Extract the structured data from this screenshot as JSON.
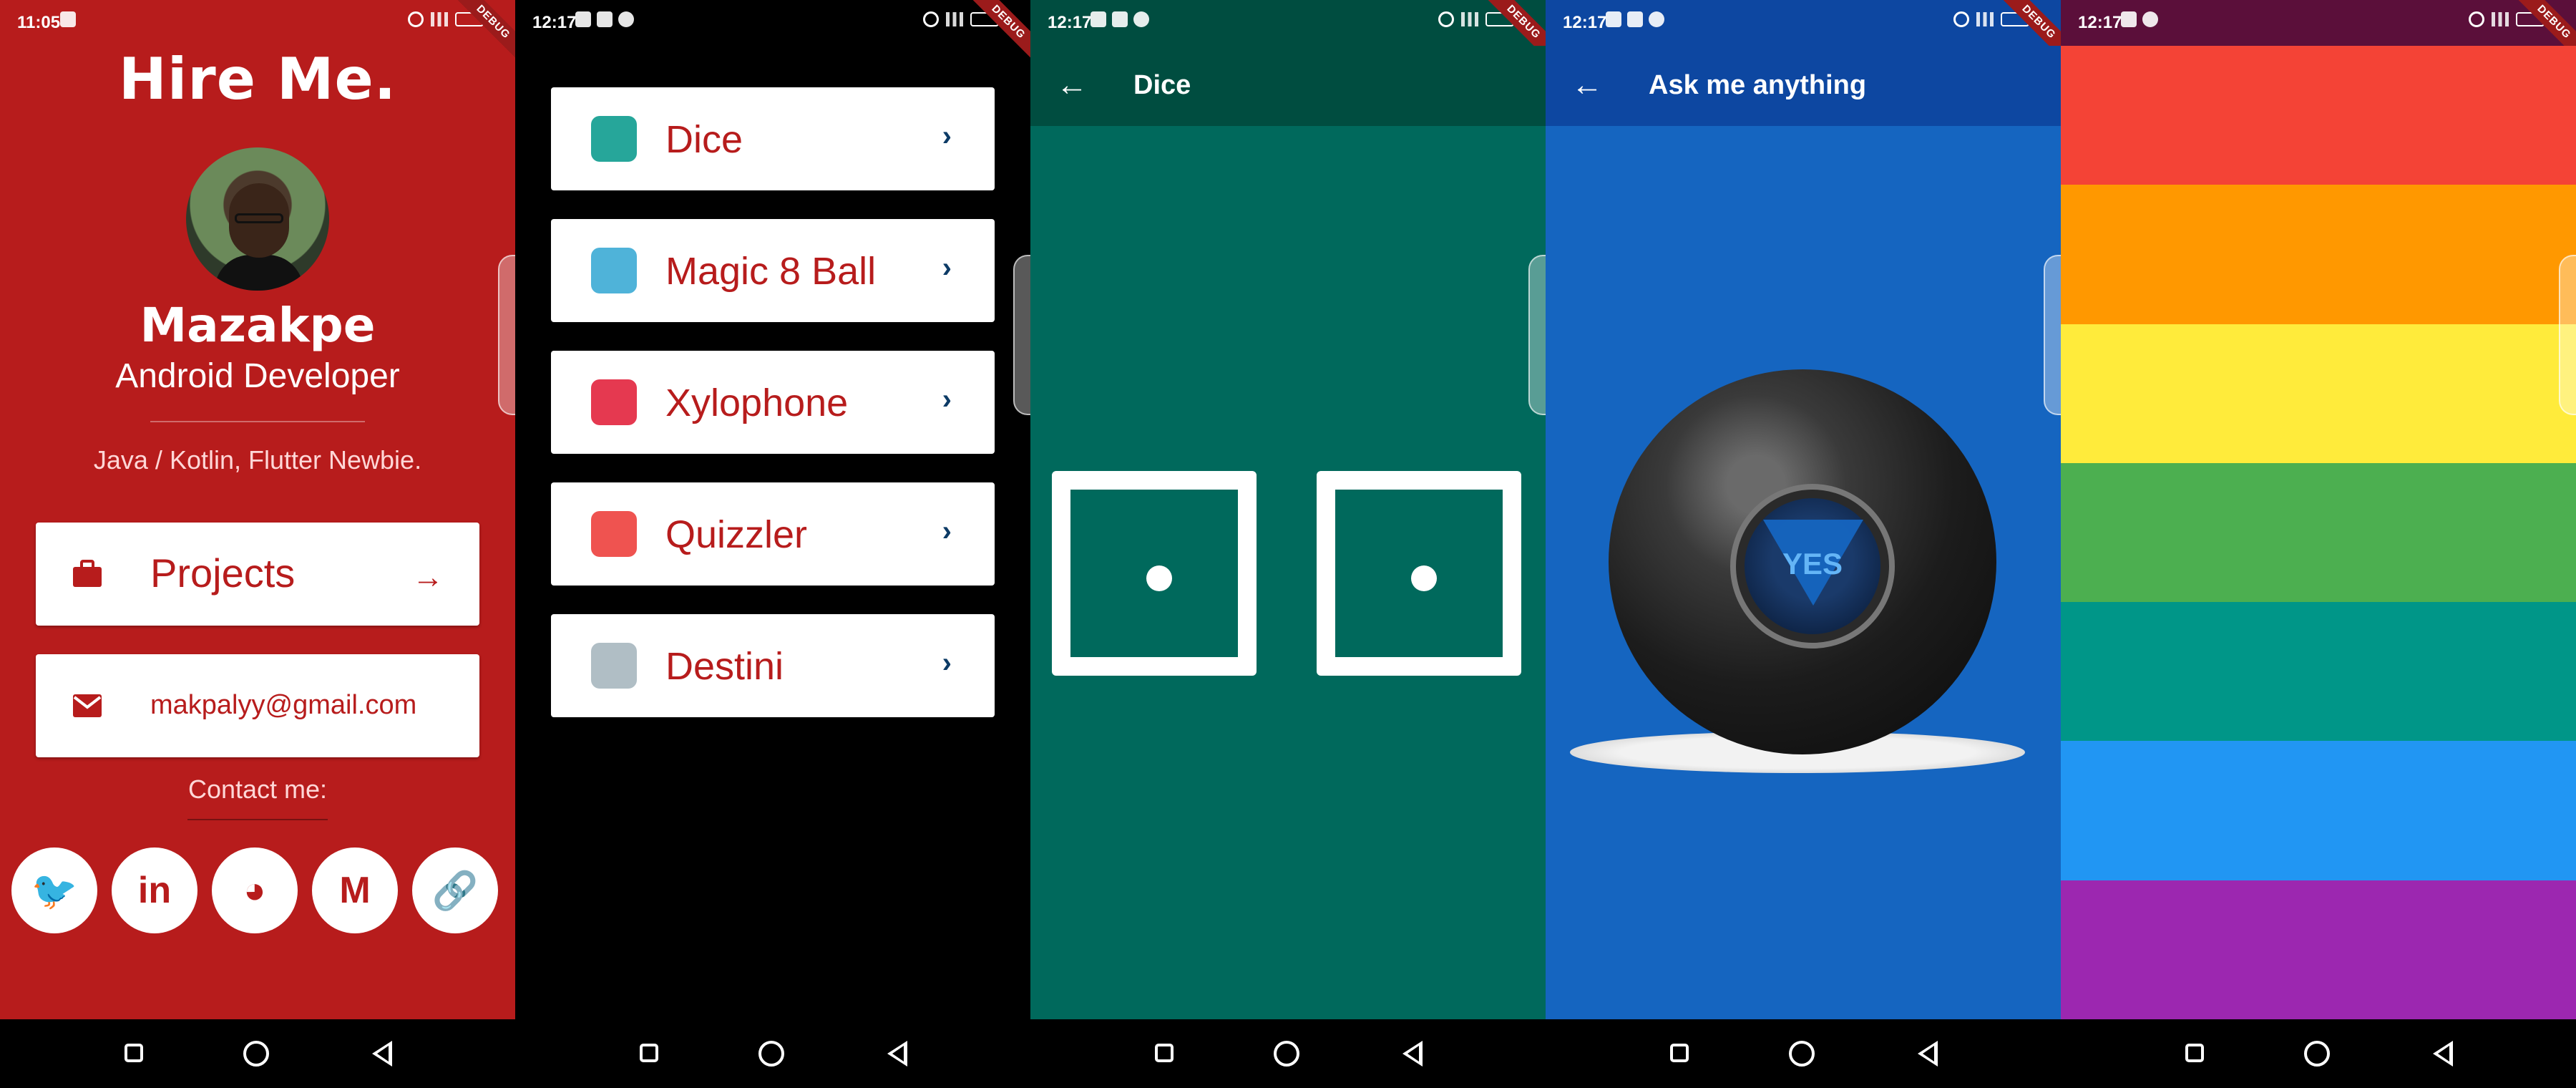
{
  "screens": {
    "profile": {
      "status_time": "11:05",
      "debug_label": "DEBUG",
      "title": "Hire Me.",
      "name": "Mazakpe",
      "role": "Android Developer",
      "tagline": "Java / Kotlin, Flutter Newbie.",
      "projects_label": "Projects",
      "email": "makpalyy@gmail.com",
      "contact_label": "Contact me:",
      "social_icons": [
        "twitter-icon",
        "linkedin-icon",
        "github-icon",
        "medium-icon",
        "link-icon"
      ],
      "social_glyphs": [
        "🐦",
        "in",
        "◕",
        "M",
        "🔗"
      ],
      "background": "#b71c1c"
    },
    "menu": {
      "status_time": "12:17",
      "debug_label": "DEBUG",
      "items": [
        {
          "label": "Dice",
          "icon": "dice-icon",
          "icon_color": "#26a69a"
        },
        {
          "label": "Magic 8 Ball",
          "icon": "eight-ball-icon",
          "icon_color": "#4fb3d9"
        },
        {
          "label": "Xylophone",
          "icon": "xylophone-icon",
          "icon_color": "#e53950"
        },
        {
          "label": "Quizzler",
          "icon": "quiz-icon",
          "icon_color": "#ef5350"
        },
        {
          "label": "Destini",
          "icon": "crystal-ball-icon",
          "icon_color": "#b0bec5"
        }
      ],
      "chevron": "›"
    },
    "dice": {
      "status_time": "12:17",
      "debug_label": "DEBUG",
      "title": "Dice",
      "back_glyph": "←",
      "dice_values": [
        1,
        1
      ],
      "background": "#00695c"
    },
    "magic8": {
      "status_time": "12:17",
      "debug_label": "DEBUG",
      "title": "Ask me anything",
      "back_glyph": "←",
      "answer": "YES",
      "background": "#1565c0"
    },
    "rainbow": {
      "status_time": "12:17",
      "debug_label": "DEBUG",
      "bands": [
        "#f44336",
        "#ff9800",
        "#ffeb3b",
        "#4caf50",
        "#009688",
        "#2196f3",
        "#9c27b0"
      ]
    }
  }
}
